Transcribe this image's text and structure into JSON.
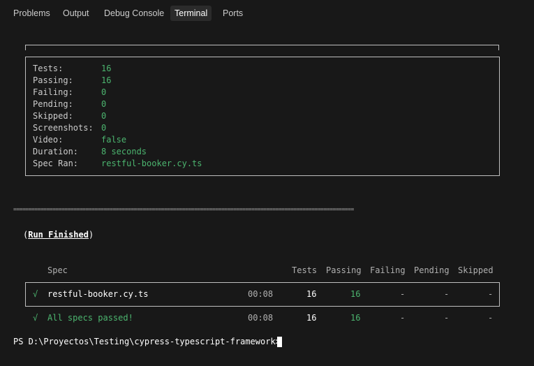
{
  "tabs": [
    {
      "label": "Problems"
    },
    {
      "label": "Output"
    },
    {
      "label": "Debug Console"
    },
    {
      "label": "Terminal"
    },
    {
      "label": "Ports"
    }
  ],
  "summary": {
    "rows": [
      {
        "key": "Tests:",
        "value": "16"
      },
      {
        "key": "Passing:",
        "value": "16"
      },
      {
        "key": "Failing:",
        "value": "0"
      },
      {
        "key": "Pending:",
        "value": "0"
      },
      {
        "key": "Skipped:",
        "value": "0"
      },
      {
        "key": "Screenshots:",
        "value": "0"
      },
      {
        "key": "Video:",
        "value": "false"
      },
      {
        "key": "Duration:",
        "value": "8 seconds"
      },
      {
        "key": "Spec Ran:",
        "value": "restful-booker.cy.ts"
      }
    ]
  },
  "separator": "=================================================================================================================",
  "run_finished": {
    "open": "(",
    "label": "Run Finished",
    "close": ")"
  },
  "results": {
    "headers": {
      "spec": "Spec",
      "tests": "Tests",
      "passing": "Passing",
      "failing": "Failing",
      "pending": "Pending",
      "skipped": "Skipped"
    },
    "row": {
      "check": "√",
      "spec": "restful-booker.cy.ts",
      "time": "00:08",
      "tests": "16",
      "passing": "16",
      "failing": "-",
      "pending": "-",
      "skipped": "-"
    },
    "total": {
      "check": "√",
      "label": "All specs passed!",
      "time": "00:08",
      "tests": "16",
      "passing": "16",
      "failing": "-",
      "pending": "-",
      "skipped": "-"
    }
  },
  "prompt": {
    "text": "PS D:\\Proyectos\\Testing\\cypress-typescript-framework>"
  },
  "colors": {
    "background": "#181818",
    "green": "#4cb56f",
    "text": "#cccccc",
    "active_tab_bg": "#2b2b2b"
  }
}
